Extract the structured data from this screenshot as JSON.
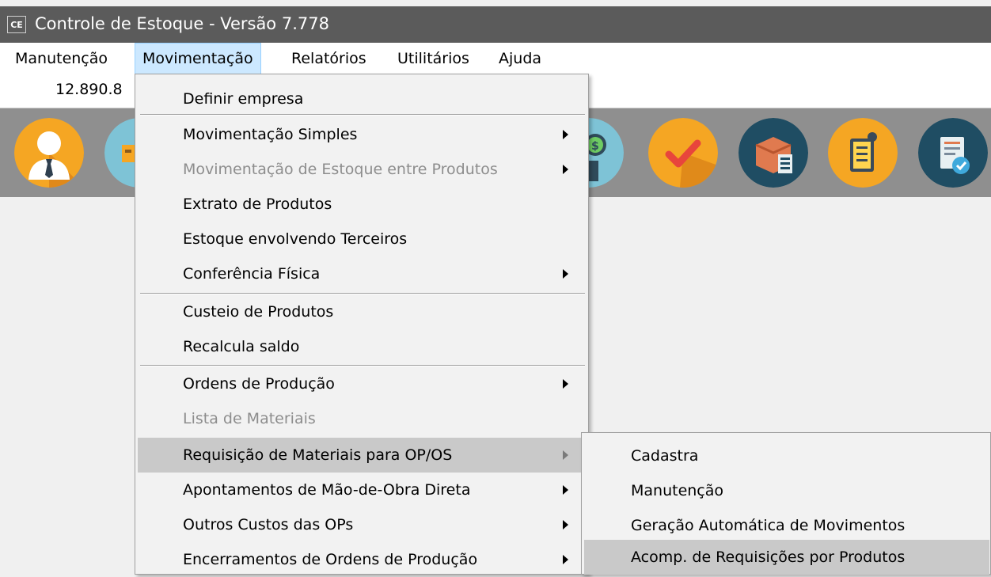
{
  "window": {
    "icon_text": "CE",
    "title": "Controle de Estoque - Versão 7.778"
  },
  "menubar": {
    "items": [
      {
        "label": "Manutenção"
      },
      {
        "label": "Movimentação"
      },
      {
        "label": "Relatórios"
      },
      {
        "label": "Utilitários"
      },
      {
        "label": "Ajuda"
      }
    ]
  },
  "value_field": {
    "text": "12.890.8"
  },
  "toolbar": {
    "icons": [
      "user-icon",
      "truck-icon",
      "money-box-icon",
      "checkmark-icon",
      "box-checklist-icon",
      "checklist-location-icon",
      "document-check-icon"
    ]
  },
  "dropdown": {
    "items": [
      {
        "label": "Definir empresa",
        "submenu": false,
        "disabled": false
      },
      {
        "label": "Movimentação Simples",
        "submenu": true,
        "disabled": false
      },
      {
        "label": "Movimentação de Estoque entre Produtos",
        "submenu": true,
        "disabled": true
      },
      {
        "label": "Extrato de Produtos",
        "submenu": false,
        "disabled": false
      },
      {
        "label": "Estoque envolvendo Terceiros",
        "submenu": false,
        "disabled": false
      },
      {
        "label": "Conferência Física",
        "submenu": true,
        "disabled": false
      },
      {
        "label": "Custeio de Produtos",
        "submenu": false,
        "disabled": false
      },
      {
        "label": "Recalcula saldo",
        "submenu": false,
        "disabled": false
      },
      {
        "label": "Ordens de Produção",
        "submenu": true,
        "disabled": false
      },
      {
        "label": "Lista de Materiais",
        "submenu": false,
        "disabled": true
      },
      {
        "label": "Requisição de Materiais para OP/OS",
        "submenu": true,
        "disabled": false,
        "highlighted": true
      },
      {
        "label": "Apontamentos de Mão-de-Obra Direta",
        "submenu": true,
        "disabled": false
      },
      {
        "label": "Outros Custos das OPs",
        "submenu": true,
        "disabled": false
      },
      {
        "label": "Encerramentos de Ordens de Produção",
        "submenu": true,
        "disabled": false
      }
    ]
  },
  "submenu": {
    "items": [
      {
        "label": "Cadastra"
      },
      {
        "label": "Manutenção"
      },
      {
        "label": "Geração Automática de Movimentos"
      },
      {
        "label": "Acomp. de Requisições por Produtos",
        "highlighted": true
      }
    ]
  }
}
